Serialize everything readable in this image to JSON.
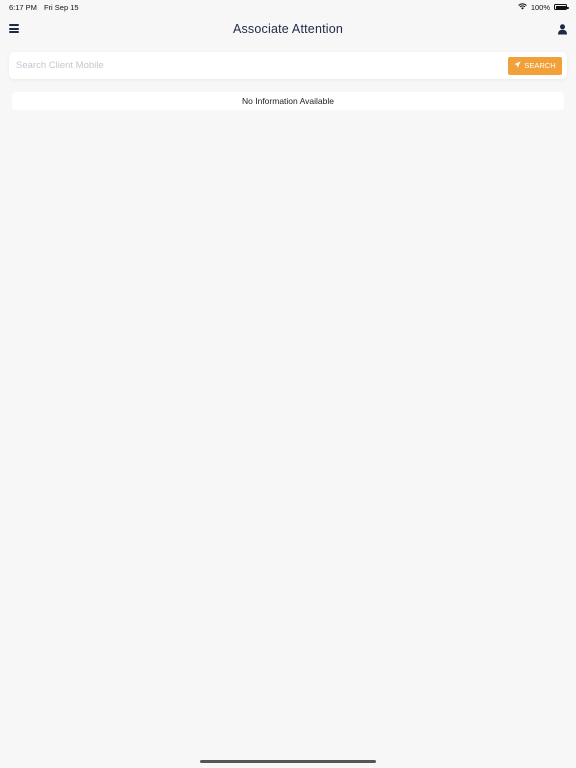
{
  "status_bar": {
    "time": "6:17 PM",
    "date": "Fri Sep 15",
    "battery_percent": "100%",
    "battery_level": 1.0,
    "wifi_icon": "wifi-icon",
    "battery_icon": "battery-icon"
  },
  "header": {
    "title": "Associate Attention",
    "menu_icon": "hamburger-menu-icon",
    "profile_icon": "user-icon"
  },
  "search": {
    "placeholder": "Search Client Mobile",
    "value": "",
    "button_label": "SEARCH",
    "button_icon": "send-icon",
    "button_color": "#f2a13a"
  },
  "results": {
    "empty_message": "No Information Available"
  },
  "colors": {
    "background": "#f7f7f7",
    "title_color": "#1f2a44",
    "accent": "#f2a13a"
  }
}
